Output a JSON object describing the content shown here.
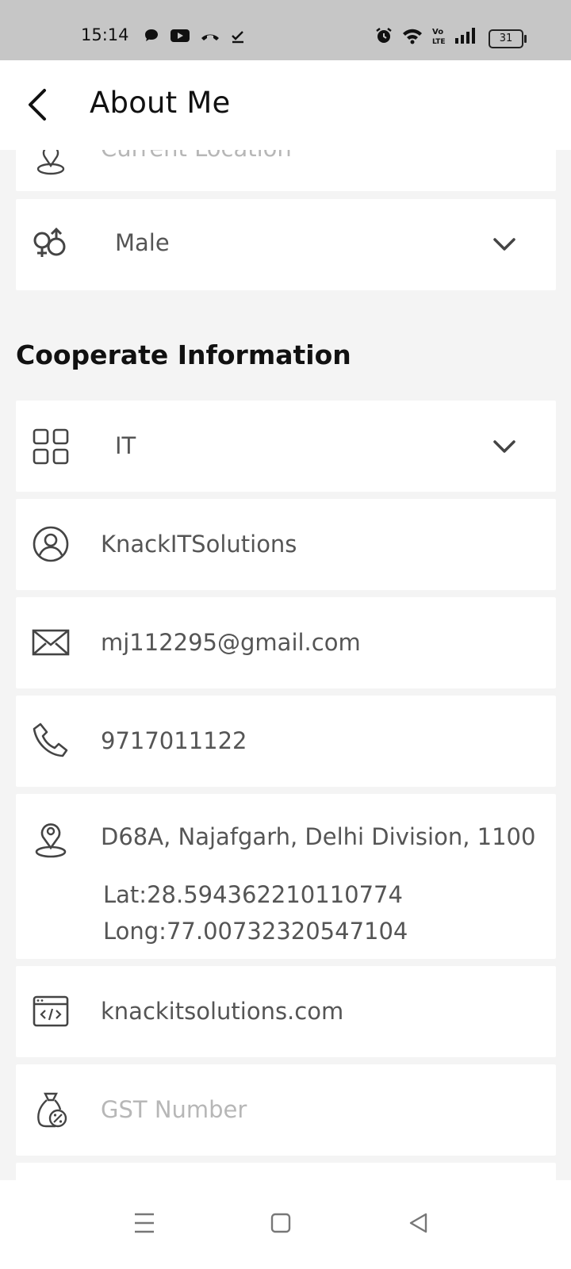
{
  "status_bar": {
    "time": "15:14",
    "left_icons": [
      "chat-bubble-icon",
      "youtube-icon",
      "missed-call-icon",
      "download-done-icon"
    ],
    "right_icons": [
      "alarm-icon",
      "wifi-icon",
      "volte-icon",
      "signal-icon"
    ],
    "battery": "31"
  },
  "header": {
    "title": "About Me"
  },
  "fields": {
    "current_location_placeholder": "Current Location",
    "gender_value": "Male"
  },
  "section": {
    "title": "Cooperate Information"
  },
  "cooperate": {
    "industry_value": "IT",
    "company_name": "KnackITSolutions",
    "email": "mj112295@gmail.com",
    "phone": "9717011122",
    "address": "D68A, Najafgarh, Delhi Division, 1100",
    "lat": "Lat:28.594362210110774",
    "long": "Long:77.00732320547104",
    "website": "knackitsolutions.com",
    "gst_placeholder": "GST Number"
  },
  "colors": {
    "background": "#f4f4f4",
    "card": "#ffffff",
    "text": "#555555",
    "placeholder": "#b7b7b7"
  }
}
